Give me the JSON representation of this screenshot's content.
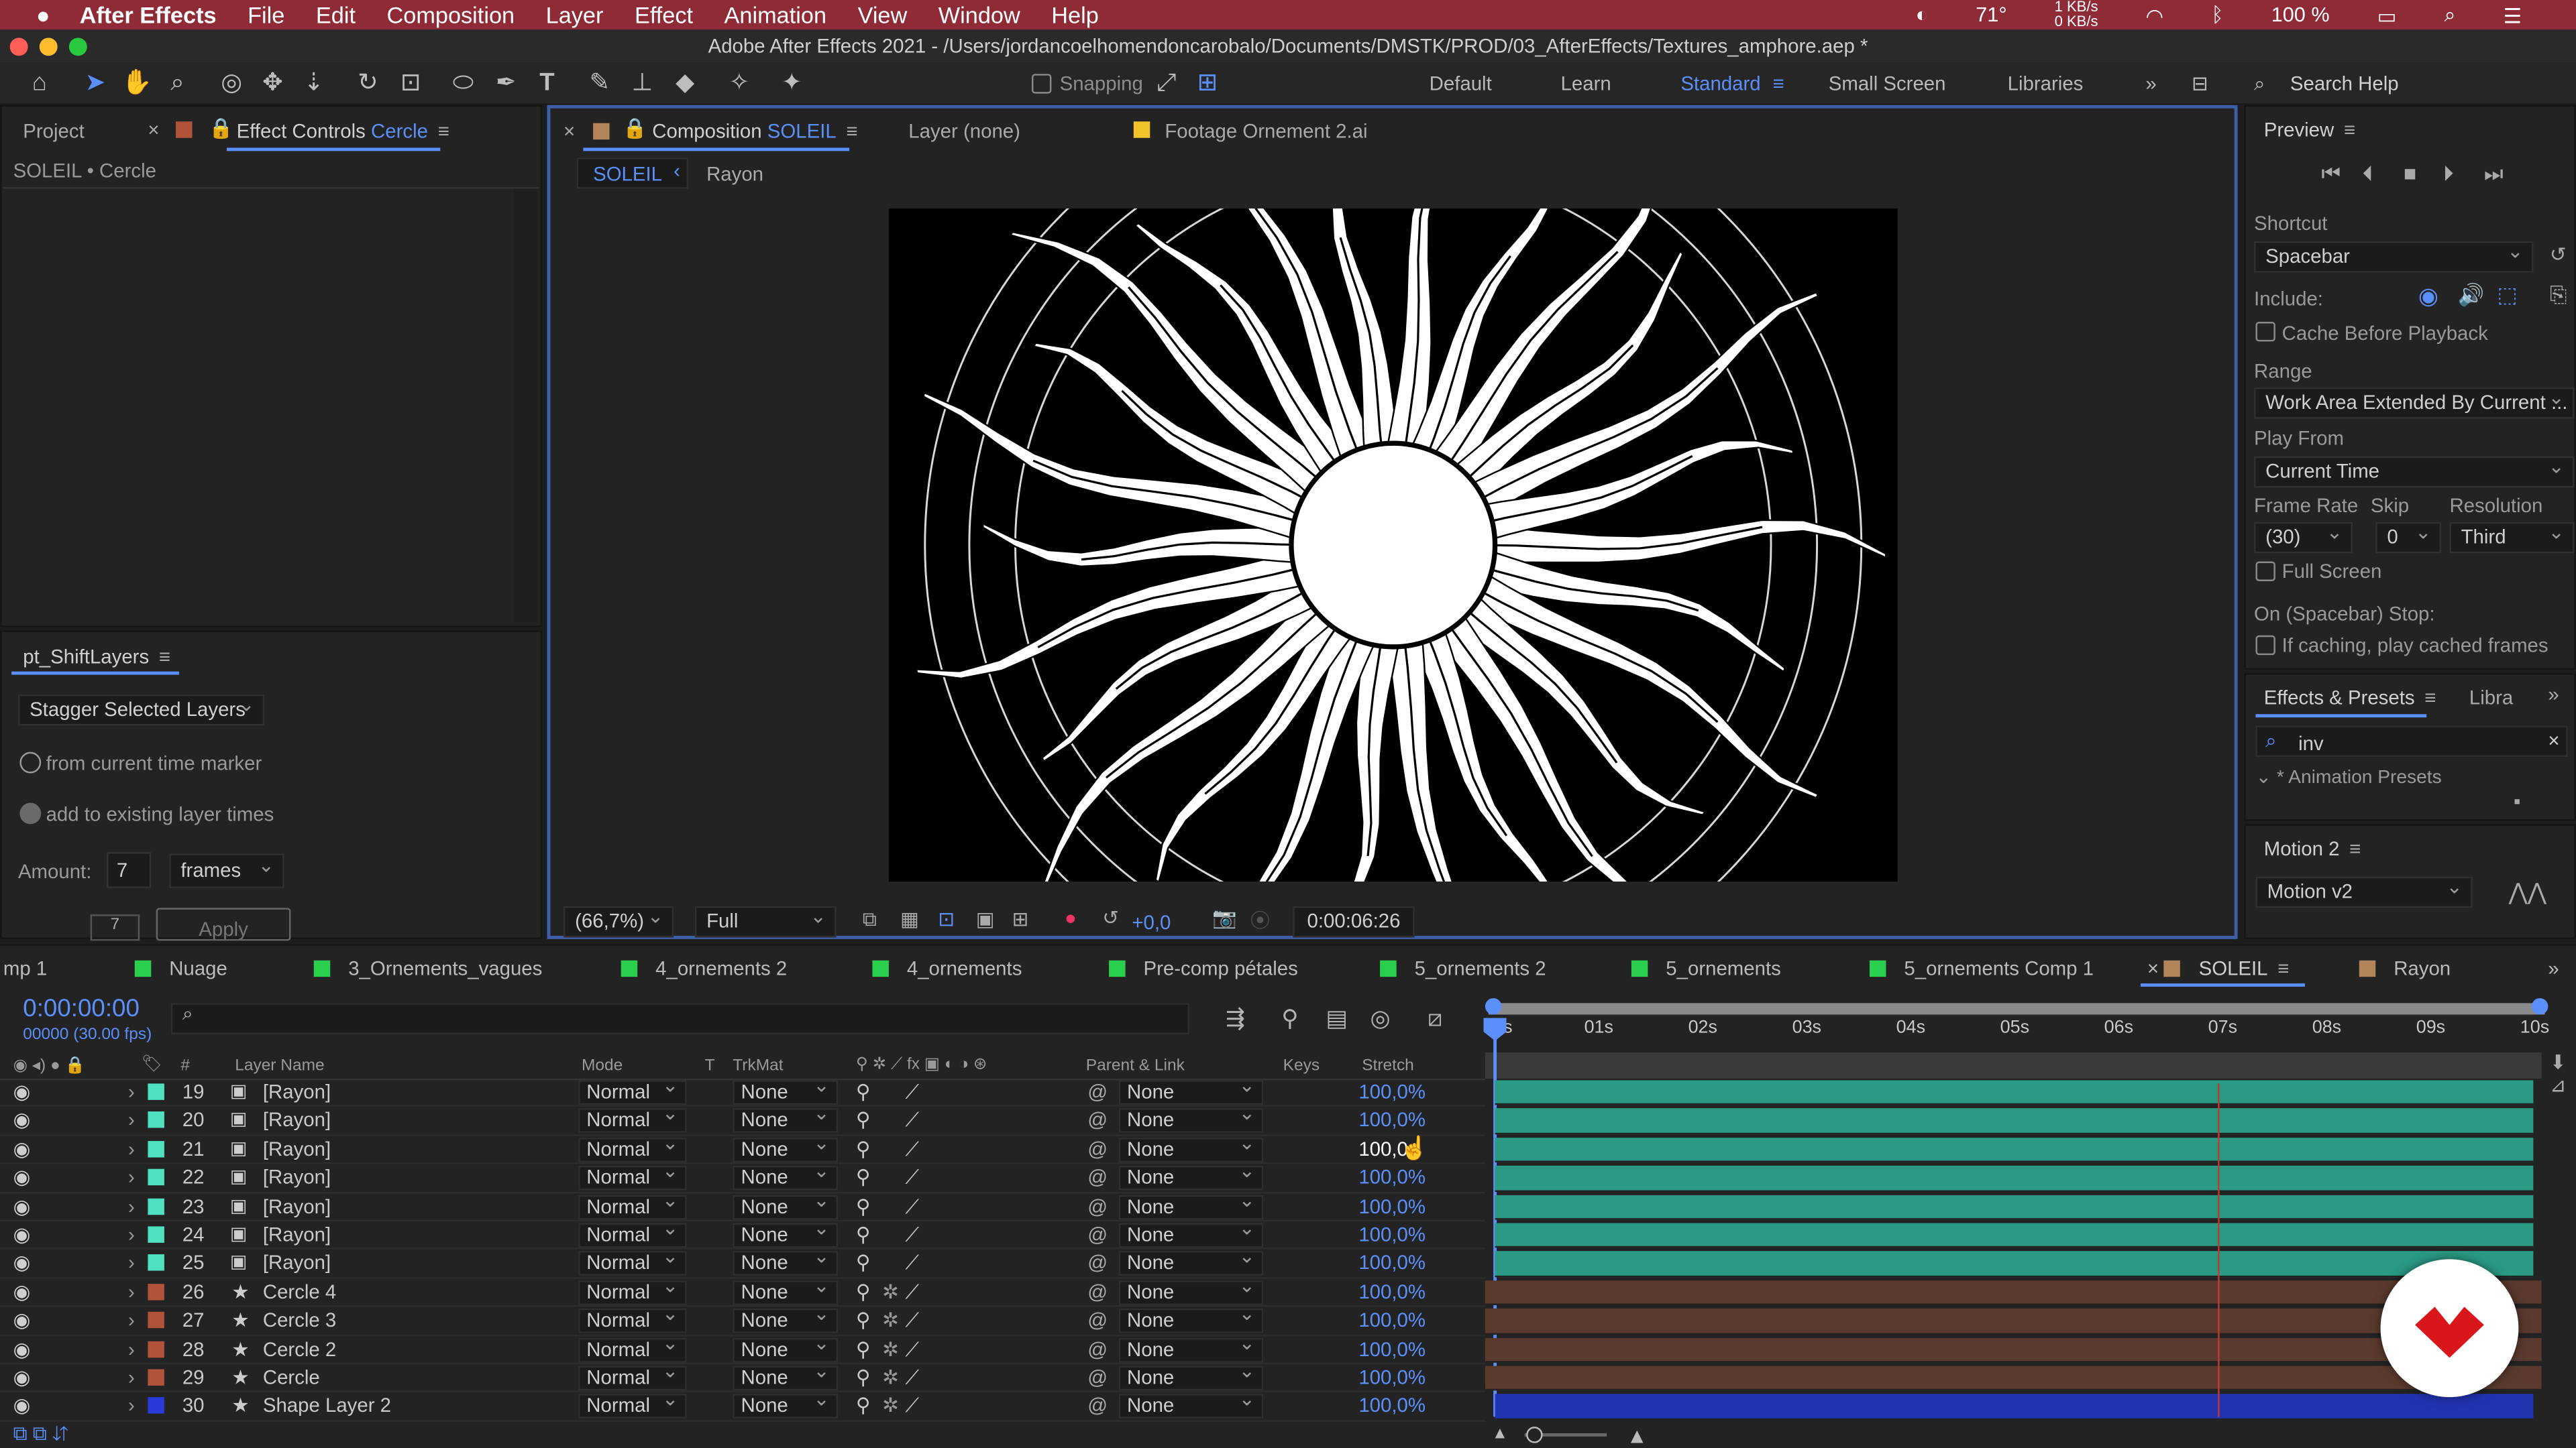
{
  "menubar": {
    "apple": "",
    "app": "After Effects",
    "items": [
      "File",
      "Edit",
      "Composition",
      "Layer",
      "Effect",
      "Animation",
      "View",
      "Window",
      "Help"
    ],
    "temp": "71°",
    "net_up": "1 KB/s",
    "net_down": "0 KB/s",
    "battery": "100 %"
  },
  "titlebar": {
    "title": "Adobe After Effects 2021 - /Users/jordancoelhomendoncarobalo/Documents/DMSTK/PROD/03_AfterEffects/Textures_amphore.aep *"
  },
  "toolbar": {
    "snapping": "Snapping",
    "workspaces": [
      "Default",
      "Learn",
      "Standard",
      "Small Screen",
      "Libraries"
    ],
    "active_workspace": "Standard",
    "search_placeholder": "Search Help"
  },
  "left_panel": {
    "tab_project": "Project",
    "tab_effect": "Effect Controls",
    "tab_effect_target": "Cercle",
    "subtitle": "SOLEIL • Cercle"
  },
  "shift_panel": {
    "title": "pt_ShiftLayers",
    "mode": "Stagger Selected Layers",
    "opt1": "from current time marker",
    "opt2": "add to existing layer times",
    "amount_label": "Amount:",
    "amount_value": "7",
    "unit": "frames",
    "small_value": "7",
    "apply": "Apply"
  },
  "comp_panel": {
    "tab_prefix": "Composition",
    "tab_name": "SOLEIL",
    "layer_tab": "Layer (none)",
    "footage_tab": "Footage Ornement 2.ai",
    "crumb1": "SOLEIL",
    "crumb2": "Rayon",
    "zoom": "(66,7%)",
    "quality": "Full",
    "exposure": "+0,0",
    "timecode": "0:00:06:26"
  },
  "preview": {
    "title": "Preview",
    "shortcut_label": "Shortcut",
    "shortcut": "Spacebar",
    "include": "Include:",
    "cache": "Cache Before Playback",
    "range_label": "Range",
    "range": "Work Area Extended By Current ...",
    "play_from_label": "Play From",
    "play_from": "Current Time",
    "frame_rate_label": "Frame Rate",
    "skip_label": "Skip",
    "resolution_label": "Resolution",
    "frame_rate": "(30)",
    "skip": "0",
    "resolution": "Third",
    "full_screen": "Full Screen",
    "stop_label": "On (Spacebar) Stop:",
    "cached": "If caching, play cached frames"
  },
  "effects": {
    "tab": "Effects & Presets",
    "tab2": "Libra",
    "search": "inv",
    "group": "* Animation Presets",
    "motion_title": "Motion 2",
    "motion_value": "Motion v2"
  },
  "timeline": {
    "tabs": [
      {
        "label": "mp 1",
        "color": "#2bcf4e"
      },
      {
        "label": "Nuage",
        "color": "#2bcf4e"
      },
      {
        "label": "3_Ornements_vagues",
        "color": "#2bcf4e"
      },
      {
        "label": "4_ornements 2",
        "color": "#2bcf4e"
      },
      {
        "label": "4_ornements",
        "color": "#2bcf4e"
      },
      {
        "label": "Pre-comp pétales",
        "color": "#2bcf4e"
      },
      {
        "label": "5_ornements 2",
        "color": "#2bcf4e"
      },
      {
        "label": "5_ornements",
        "color": "#2bcf4e"
      },
      {
        "label": "5_ornements Comp 1",
        "color": "#2bcf4e"
      },
      {
        "label": "SOLEIL",
        "color": "#b1845a"
      },
      {
        "label": "Rayon",
        "color": "#b1845a"
      }
    ],
    "timecode": "0:00:00:00",
    "frames": "00000 (30.00 fps)",
    "columns": {
      "layer_name": "Layer Name",
      "mode": "Mode",
      "t": "T",
      "trkmat": "TrkMat",
      "parent": "Parent & Link",
      "keys": "Keys",
      "stretch": "Stretch"
    },
    "ruler": [
      "0s",
      "01s",
      "02s",
      "03s",
      "04s",
      "05s",
      "06s",
      "07s",
      "08s",
      "09s",
      "10s"
    ],
    "layers": [
      {
        "num": "19",
        "name": "[Rayon]",
        "mode": "Normal",
        "trk": "None",
        "parent": "None",
        "stretch": "100,0%",
        "color": "#4fe0c0",
        "bar": "#2a9a84",
        "type": "comp"
      },
      {
        "num": "20",
        "name": "[Rayon]",
        "mode": "Normal",
        "trk": "None",
        "parent": "None",
        "stretch": "100,0%",
        "color": "#4fe0c0",
        "bar": "#2a9a84",
        "type": "comp"
      },
      {
        "num": "21",
        "name": "[Rayon]",
        "mode": "Normal",
        "trk": "None",
        "parent": "None",
        "stretch": "100,0",
        "color": "#4fe0c0",
        "bar": "#2a9a84",
        "type": "comp"
      },
      {
        "num": "22",
        "name": "[Rayon]",
        "mode": "Normal",
        "trk": "None",
        "parent": "None",
        "stretch": "100,0%",
        "color": "#4fe0c0",
        "bar": "#2a9a84",
        "type": "comp"
      },
      {
        "num": "23",
        "name": "[Rayon]",
        "mode": "Normal",
        "trk": "None",
        "parent": "None",
        "stretch": "100,0%",
        "color": "#4fe0c0",
        "bar": "#2a9a84",
        "type": "comp"
      },
      {
        "num": "24",
        "name": "[Rayon]",
        "mode": "Normal",
        "trk": "None",
        "parent": "None",
        "stretch": "100,0%",
        "color": "#4fe0c0",
        "bar": "#2a9a84",
        "type": "comp"
      },
      {
        "num": "25",
        "name": "[Rayon]",
        "mode": "Normal",
        "trk": "None",
        "parent": "None",
        "stretch": "100,0%",
        "color": "#4fe0c0",
        "bar": "#2a9a84",
        "type": "comp"
      },
      {
        "num": "26",
        "name": "Cercle 4",
        "mode": "Normal",
        "trk": "None",
        "parent": "None",
        "stretch": "100,0%",
        "color": "#b1533a",
        "bar": "#5a3a2e",
        "type": "shape"
      },
      {
        "num": "27",
        "name": "Cercle 3",
        "mode": "Normal",
        "trk": "None",
        "parent": "None",
        "stretch": "100,0%",
        "color": "#b1533a",
        "bar": "#5a3a2e",
        "type": "shape"
      },
      {
        "num": "28",
        "name": "Cercle 2",
        "mode": "Normal",
        "trk": "None",
        "parent": "None",
        "stretch": "100,0%",
        "color": "#b1533a",
        "bar": "#5a3a2e",
        "type": "shape"
      },
      {
        "num": "29",
        "name": "Cercle",
        "mode": "Normal",
        "trk": "None",
        "parent": "None",
        "stretch": "100,0%",
        "color": "#b1533a",
        "bar": "#5a3a2e",
        "type": "shape"
      },
      {
        "num": "30",
        "name": "Shape Layer 2",
        "mode": "Normal",
        "trk": "None",
        "parent": "None",
        "stretch": "100,0%",
        "color": "#2a3ad8",
        "bar": "#2233b0",
        "type": "shape"
      }
    ]
  }
}
